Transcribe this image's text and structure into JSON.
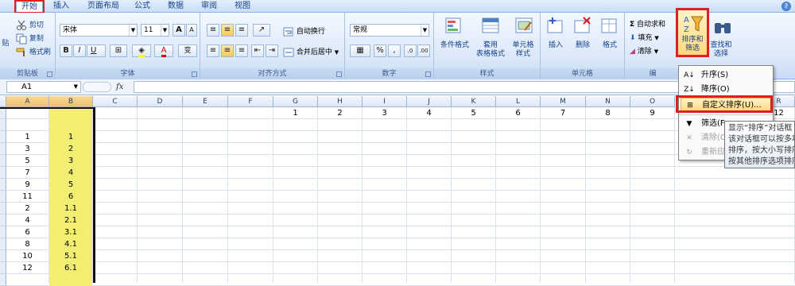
{
  "tabs": [
    "开始",
    "插入",
    "页面布局",
    "公式",
    "数据",
    "审阅",
    "视图"
  ],
  "clipboard": {
    "paste": "贴",
    "cut": "剪切",
    "copy": "复制",
    "format_painter": "格式刷",
    "label": "剪贴板"
  },
  "font": {
    "name": "宋体",
    "size": "11",
    "grow": "A",
    "shrink": "A",
    "bold": "B",
    "italic": "I",
    "underline": "U",
    "label": "字体",
    "phonetic": "变"
  },
  "alignment": {
    "wrap": "自动换行",
    "merge": "合并后居中",
    "label": "对齐方式"
  },
  "number": {
    "format": "常规",
    "percent": "%",
    "comma": ",",
    "label": "数字"
  },
  "styles": {
    "conditional": "条件格式",
    "table_line1": "套用",
    "table_line2": "表格格式",
    "cell_style_line1": "单元格",
    "cell_style_line2": "样式",
    "label": "样式"
  },
  "cells": {
    "insert": "插入",
    "delete": "删除",
    "format": "格式",
    "label": "单元格"
  },
  "editing": {
    "autosum": "自动求和",
    "fill": "填充",
    "clear": "清除",
    "sort_filter_line1": "排序和",
    "sort_filter_line2": "筛选",
    "find_line1": "查找和",
    "find_line2": "选择",
    "label": "编"
  },
  "formula_bar": {
    "name_box": "A1",
    "fx": "fx"
  },
  "columns": [
    "A",
    "B",
    "C",
    "D",
    "E",
    "F",
    "G",
    "H",
    "I",
    "J",
    "K",
    "L",
    "M",
    "N",
    "O",
    "R"
  ],
  "row1_values": [
    "1",
    "2",
    "3",
    "4",
    "5",
    "6",
    "7",
    "8",
    "9",
    "12"
  ],
  "col_a": [
    "1",
    "3",
    "5",
    "7",
    "9",
    "11",
    "2",
    "4",
    "6",
    "8",
    "10",
    "12"
  ],
  "col_b": [
    "1",
    "2",
    "3",
    "4",
    "5",
    "6",
    "1.1",
    "2.1",
    "3.1",
    "4.1",
    "5.1",
    "6.1"
  ],
  "menu": {
    "ascending": "升序(S)",
    "descending": "降序(O)",
    "custom": "自定义排序(U)...",
    "filter": "筛选(F",
    "clear": "清除(C",
    "reapply": "重新应"
  },
  "tooltip": [
    "显示“排序”对话框",
    "该对话框可以按多项",
    "排序，按大小写排序",
    "按其他排序选项排序"
  ],
  "colors": {
    "highlight_box": "#e02020",
    "column_b_fill": "#f1ee72"
  }
}
